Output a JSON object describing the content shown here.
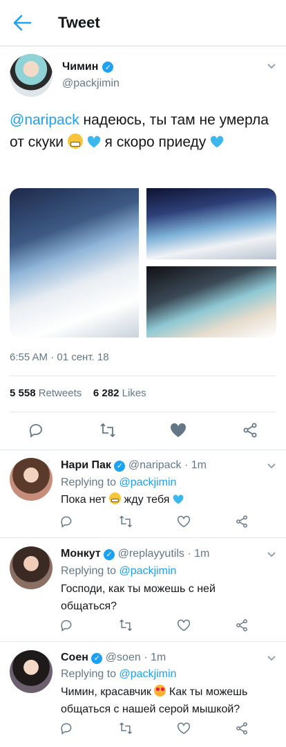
{
  "header": {
    "title": "Tweet"
  },
  "main_tweet": {
    "author_name": "Чимин",
    "author_handle": "@packjimin",
    "text_mention": "@naripack",
    "text_1": " надеюсь, ты там не умерла от скуки ",
    "text_2": " я скоро приеду ",
    "timestamp": "6:55 AM · 01 сент. 18",
    "retweets_count": "5 558",
    "retweets_label": "Retweets",
    "likes_count": "6 282",
    "likes_label": "Likes"
  },
  "replies": [
    {
      "name": "Нари Пак",
      "handle": "@naripack",
      "time": "· 1m",
      "replying_label": "Replying to",
      "replying_to": "@packjimin",
      "text_a": "Пока нет ",
      "text_b": " жду тебя "
    },
    {
      "name": "Монкут",
      "handle": "@replayyutils",
      "time": "· 1m",
      "replying_label": "Replying to",
      "replying_to": "@packjimin",
      "text": "Господи, как ты можешь с ней общаться?"
    },
    {
      "name": "Соен",
      "handle": "@soen",
      "time": "· 1m",
      "replying_label": "Replying to",
      "replying_to": "@packjimin",
      "text_a": "Чимин, красавчик ",
      "text_b": " Как ты можешь общаться с нашей серой мышкой?"
    }
  ],
  "colors": {
    "accent": "#1da1f2",
    "muted": "#657786",
    "text": "#14171a",
    "liked": "#657786"
  },
  "icons": [
    "back-arrow-icon",
    "verified-icon",
    "chevron-down-icon",
    "reply-icon",
    "retweet-icon",
    "like-icon",
    "share-icon",
    "grinning-emoji",
    "blue-heart-emoji",
    "heart-eyes-emoji"
  ]
}
